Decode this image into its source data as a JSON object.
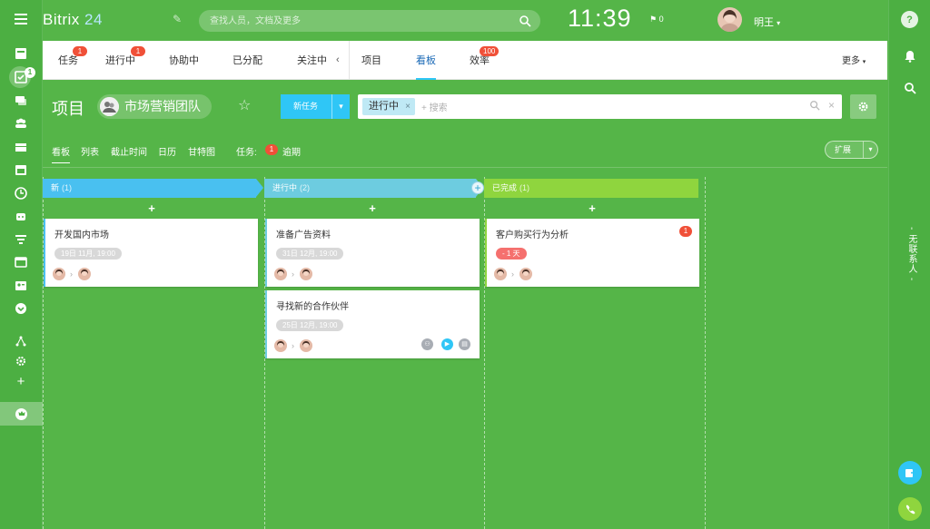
{
  "header": {
    "logo_name": "Bitrix",
    "logo_num": "24",
    "search_placeholder": "查找人员，文档及更多",
    "clock": "11:39",
    "flag_count": "0",
    "user_name": "明王"
  },
  "tabs": [
    {
      "label": "任务",
      "badge": "1"
    },
    {
      "label": "进行中",
      "badge": "1"
    },
    {
      "label": "协助中",
      "badge": ""
    },
    {
      "label": "已分配",
      "badge": ""
    },
    {
      "label": "关注中",
      "badge": ""
    },
    {
      "label": "项目",
      "badge": ""
    },
    {
      "label": "看板",
      "badge": "",
      "active": true
    },
    {
      "label": "效率",
      "badge": "100"
    }
  ],
  "tabs_more": "更多",
  "page": {
    "title": "项目",
    "group_name": "市场营销团队",
    "new_task_label": "新任务",
    "filter_chip": "进行中",
    "filter_placeholder": "+ 搜索"
  },
  "subnav": {
    "items": [
      "看板",
      "列表",
      "截止时间",
      "日历",
      "甘特图"
    ],
    "tasks_label": "任务:",
    "overdue_count": "1",
    "overdue_label": "逾期",
    "expand_label": "扩展"
  },
  "columns": [
    {
      "name": "新",
      "count": "(1)",
      "color": "#49c0f0"
    },
    {
      "name": "进行中",
      "count": "(2)",
      "color": "#6dcce0"
    },
    {
      "name": "已完成",
      "count": "(1)",
      "color": "#8fd53e"
    }
  ],
  "cards": [
    {
      "title": "开发国内市场",
      "date": "19日 11月, 19:00",
      "column": "新"
    },
    {
      "title": "准备广告资料",
      "date": "31日 12月, 19:00",
      "column": "进行中"
    },
    {
      "title": "寻找新的合作伙伴",
      "date": "25日 12月, 19:00",
      "column": "进行中"
    },
    {
      "title": "客户购买行为分析",
      "date": "- 1 天",
      "column": "已完成",
      "badge": "1"
    }
  ],
  "add_label": "+",
  "rightbar": {
    "vertical_text": "- 无联系人 -"
  },
  "colors": {
    "background": "#55b548",
    "sidebar": "#4caf42",
    "accent": "#2fc6f6",
    "badge": "#f05038"
  }
}
